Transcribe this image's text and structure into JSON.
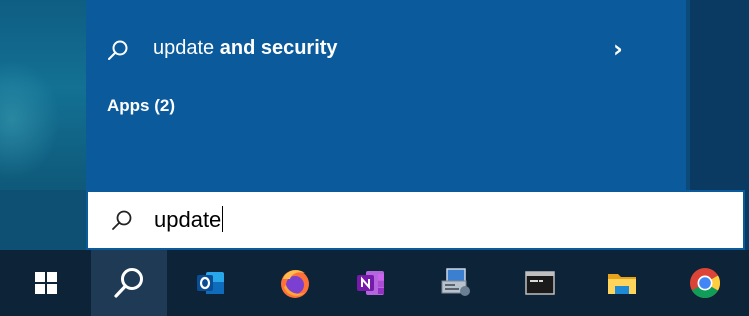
{
  "flyout": {
    "best_match": {
      "prefix": "update ",
      "bold": "and security",
      "chevron": "›"
    },
    "apps_header": "Apps (2)"
  },
  "search": {
    "value": "update"
  },
  "taskbar": {
    "items": [
      {
        "name": "start",
        "icon": "windows-logo-icon"
      },
      {
        "name": "search",
        "icon": "search-icon",
        "active": true
      },
      {
        "name": "outlook",
        "icon": "outlook-icon"
      },
      {
        "name": "firefox",
        "icon": "firefox-icon"
      },
      {
        "name": "onenote",
        "icon": "onenote-icon"
      },
      {
        "name": "control-panel",
        "icon": "control-panel-icon"
      },
      {
        "name": "command-prompt",
        "icon": "command-prompt-icon"
      },
      {
        "name": "file-explorer",
        "icon": "file-explorer-icon"
      },
      {
        "name": "chrome",
        "icon": "chrome-icon"
      }
    ]
  },
  "colors": {
    "flyout_bg": "#0a5a9c",
    "taskbar_bg": "#0d2338",
    "search_bg": "#ffffff"
  }
}
